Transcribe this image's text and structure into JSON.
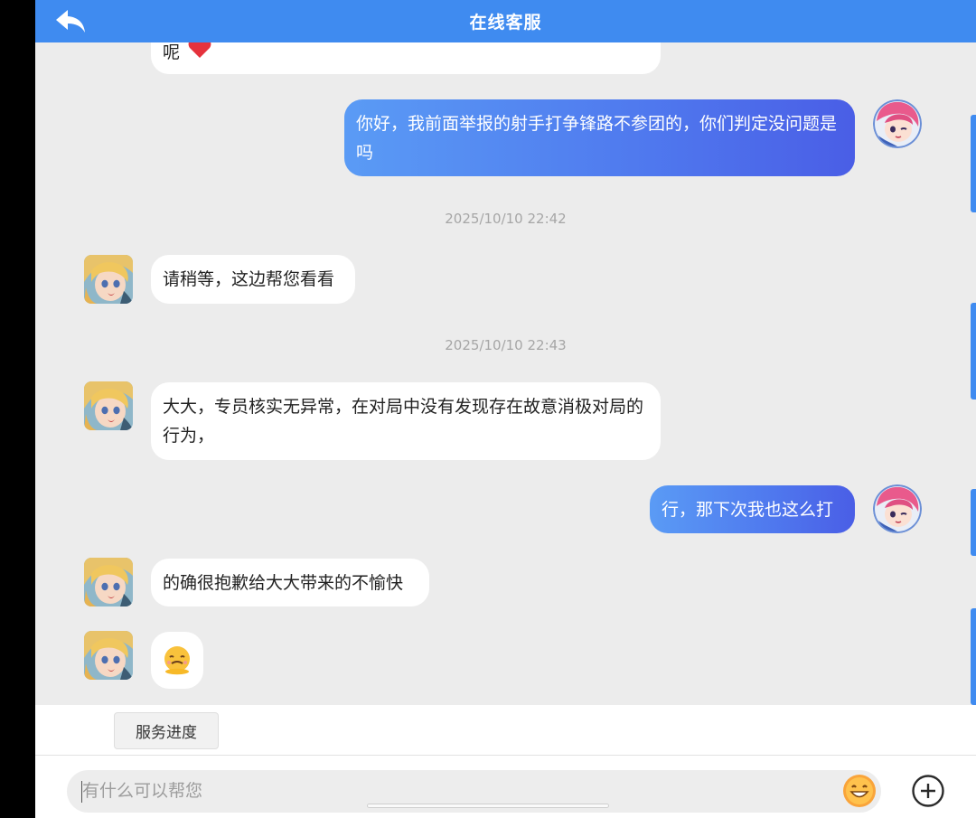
{
  "header": {
    "title": "在线客服"
  },
  "messages": {
    "m0": "呢",
    "m1": "你好，我前面举报的射手打争锋路不参团的，你们判定没问题是吗",
    "ts1": "2025/10/10 22:42",
    "m2": "请稍等，这边帮您看看",
    "ts2": "2025/10/10 22:43",
    "m3": "大大，专员核实无异常，在对局中没有发现存在故意消极对局的行为，",
    "m4": "行，那下次我也这么打",
    "m5": "的确很抱歉给大大带来的不愉快",
    "m6": "🫠"
  },
  "quick": {
    "service_progress": "服务进度"
  },
  "input": {
    "placeholder": "有什么可以帮您"
  },
  "colors": {
    "header": "#3f8bf0",
    "user_bubble_start": "#5a9bf5",
    "user_bubble_end": "#4a5ee6",
    "chat_bg": "#ececec"
  }
}
